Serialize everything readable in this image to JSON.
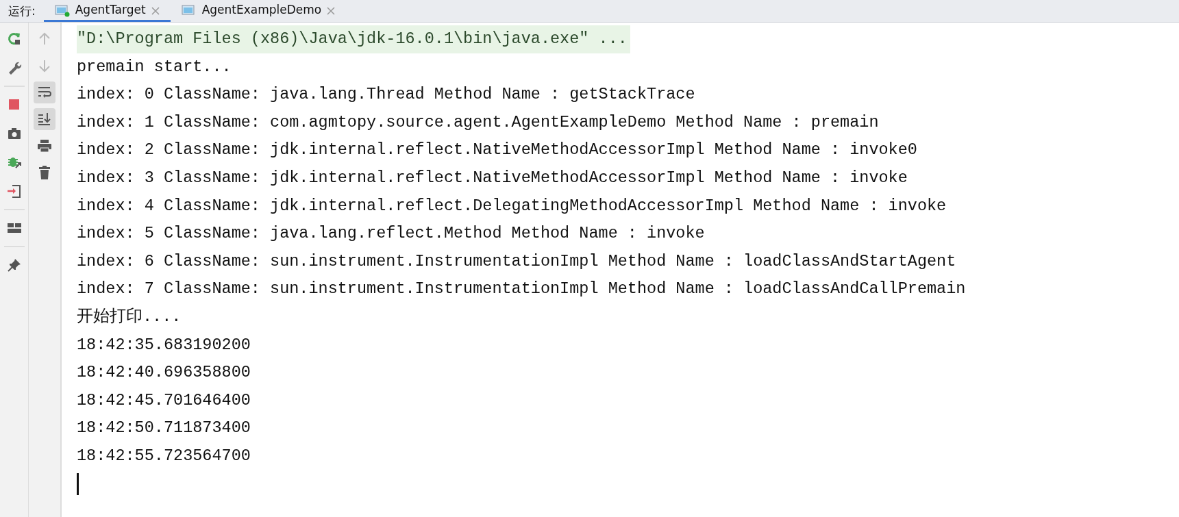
{
  "run_label": "运行:",
  "tabs": [
    {
      "label": "AgentTarget",
      "selected": true,
      "running": true
    },
    {
      "label": "AgentExampleDemo",
      "selected": false,
      "running": false
    }
  ],
  "toolbar_right": [
    {
      "disabled": true,
      "selected": false
    },
    {
      "disabled": true,
      "selected": false
    },
    {
      "disabled": false,
      "selected": true
    },
    {
      "disabled": false,
      "selected": true
    },
    {
      "disabled": false,
      "selected": false
    },
    {
      "disabled": false,
      "selected": false
    }
  ],
  "console_lines": [
    {
      "kind": "command",
      "text": "\"D:\\Program Files (x86)\\Java\\jdk-16.0.1\\bin\\java.exe\" ..."
    },
    {
      "kind": "output",
      "text": "premain start..."
    },
    {
      "kind": "output",
      "text": "index: 0 ClassName: java.lang.Thread Method Name : getStackTrace"
    },
    {
      "kind": "output",
      "text": "index: 1 ClassName: com.agmtopy.source.agent.AgentExampleDemo Method Name : premain"
    },
    {
      "kind": "output",
      "text": "index: 2 ClassName: jdk.internal.reflect.NativeMethodAccessorImpl Method Name : invoke0"
    },
    {
      "kind": "output",
      "text": "index: 3 ClassName: jdk.internal.reflect.NativeMethodAccessorImpl Method Name : invoke"
    },
    {
      "kind": "output",
      "text": "index: 4 ClassName: jdk.internal.reflect.DelegatingMethodAccessorImpl Method Name : invoke"
    },
    {
      "kind": "output",
      "text": "index: 5 ClassName: java.lang.reflect.Method Method Name : invoke"
    },
    {
      "kind": "output",
      "text": "index: 6 ClassName: sun.instrument.InstrumentationImpl Method Name : loadClassAndStartAgent"
    },
    {
      "kind": "output",
      "text": "index: 7 ClassName: sun.instrument.InstrumentationImpl Method Name : loadClassAndCallPremain"
    },
    {
      "kind": "output",
      "text": "开始打印...."
    },
    {
      "kind": "output",
      "text": "18:42:35.683190200"
    },
    {
      "kind": "output",
      "text": "18:42:40.696358800"
    },
    {
      "kind": "output",
      "text": "18:42:45.701646400"
    },
    {
      "kind": "output",
      "text": "18:42:50.711873400"
    },
    {
      "kind": "output",
      "text": "18:42:55.723564700"
    }
  ],
  "caret": true
}
